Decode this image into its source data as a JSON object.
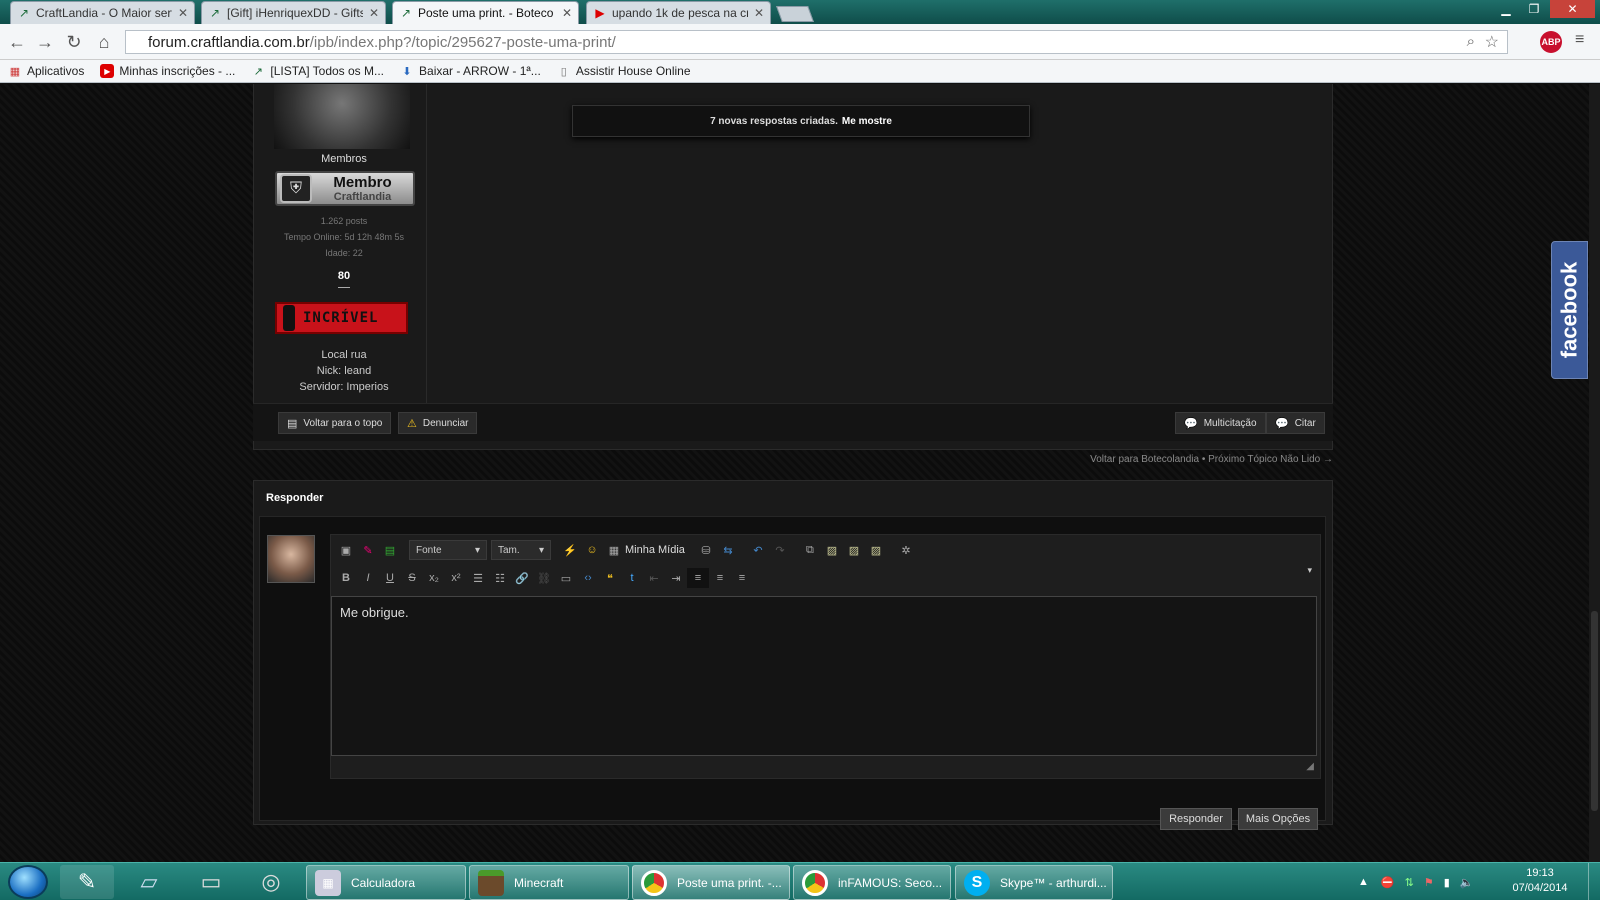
{
  "browser": {
    "tabs": [
      {
        "label": "CraftLandia - O Maior serv",
        "icon": "craftlandia-icon"
      },
      {
        "label": "[Gift] iHenriquexDD - Gifts",
        "icon": "craftlandia-icon"
      },
      {
        "label": "Poste uma print. - Boteco",
        "icon": "craftlandia-icon",
        "active": true
      },
      {
        "label": "upando 1k de pesca na cr",
        "icon": "youtube-icon"
      }
    ],
    "url_domain": "forum.craftlandia.com.br",
    "url_path": "/ipb/index.php?/topic/295627-poste-uma-print/",
    "abp": "ABP",
    "bookmarks": [
      {
        "label": "Aplicativos",
        "icon": "apps-icon"
      },
      {
        "label": "Minhas inscrições - ...",
        "icon": "youtube-icon"
      },
      {
        "label": "[LISTA] Todos os M...",
        "icon": "craftlandia-icon"
      },
      {
        "label": "Baixar - ARROW - 1ª...",
        "icon": "download-icon"
      },
      {
        "label": "Assistir House Online",
        "icon": "page-icon"
      }
    ]
  },
  "user": {
    "group": "Membros",
    "badge_title": "Membro",
    "badge_sub": "Craftlandia",
    "posts": "1.262 posts",
    "online": "Tempo Online: 5d 12h 48m 5s",
    "age": "Idade: 22",
    "rep": "80",
    "rep_label": "INCRÍVEL",
    "local": "Local rua",
    "nick": "Nick: leand",
    "server": "Servidor: Imperios"
  },
  "notify": {
    "text": "7 novas respostas criadas.",
    "link": "Me mostre"
  },
  "post_actions": {
    "top": "Voltar para o topo",
    "report": "Denunciar",
    "multiquote": "Multicitação",
    "quote": "Citar"
  },
  "topic_nav": "Voltar para Botecolandia • Próximo Tópico Não Lido →",
  "reply": {
    "title": "Responder",
    "font_label": "Fonte",
    "size_label": "Tam.",
    "media_label": "Minha Mídia",
    "text": "Me obrigue.",
    "submit": "Responder",
    "more": "Mais Opções"
  },
  "facebook": "facebook",
  "taskbar": {
    "buttons": [
      {
        "label": "Calculadora",
        "icon": "calculator-icon"
      },
      {
        "label": "Minecraft",
        "icon": "minecraft-icon"
      },
      {
        "label": "Poste uma print. -...",
        "icon": "chrome-icon",
        "active": true
      },
      {
        "label": "inFAMOUS: Seco...",
        "icon": "chrome-icon"
      },
      {
        "label": "Skype™ - arthurdi...",
        "icon": "skype-icon"
      }
    ],
    "time": "19:13",
    "date": "07/04/2014"
  }
}
